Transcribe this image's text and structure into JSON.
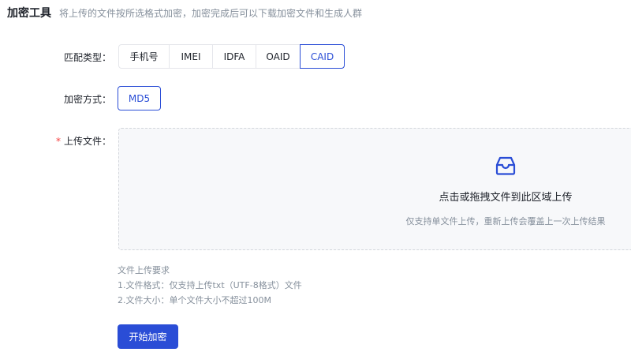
{
  "header": {
    "title": "加密工具",
    "description": "将上传的文件按所选格式加密，加密完成后可以下载加密文件和生成人群"
  },
  "match_type": {
    "label": "匹配类型：",
    "options": [
      "手机号",
      "IMEI",
      "IDFA",
      "OAID",
      "CAID"
    ],
    "selected": "CAID"
  },
  "encrypt_method": {
    "label": "加密方式：",
    "value": "MD5"
  },
  "upload": {
    "required_mark": "*",
    "label": "上传文件：",
    "main_text": "点击或拖拽文件到此区域上传",
    "sub_text": "仅支持单文件上传，重新上传会覆盖上一次上传结果",
    "icon": "inbox-icon",
    "accent_color": "#2a4dd6"
  },
  "requirements": {
    "title": "文件上传要求",
    "line1": "1.文件格式：仅支持上传txt（UTF-8格式）文件",
    "line2": "2.文件大小：单个文件大小不超过100M"
  },
  "start_button": {
    "label": "开始加密",
    "color": "#2a4dd6"
  }
}
